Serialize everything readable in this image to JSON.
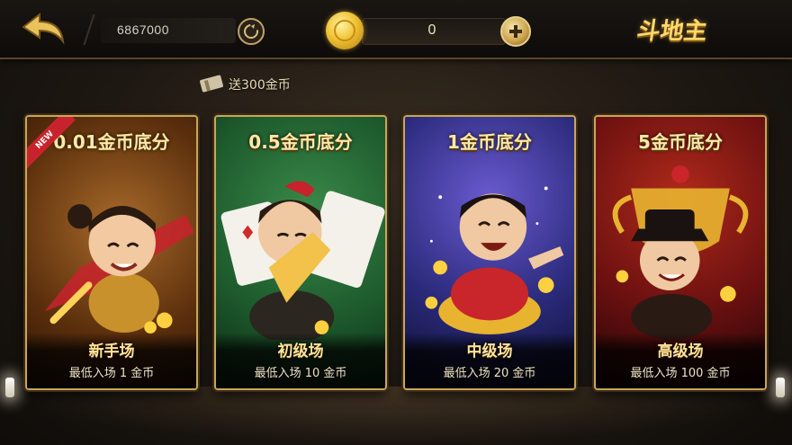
{
  "header": {
    "user_id": "6867000",
    "coins": "0",
    "game_logo": "斗地主"
  },
  "promo": {
    "text": "送300金币"
  },
  "rooms": [
    {
      "title": "0.01金币底分",
      "name": "新手场",
      "min_entry": "最低入场 1 金币",
      "badge": "NEW",
      "theme_color": "#6b3a12"
    },
    {
      "title": "0.5金币底分",
      "name": "初级场",
      "min_entry": "最低入场 10 金币",
      "theme_color": "#1d5a2c"
    },
    {
      "title": "1金币底分",
      "name": "中级场",
      "min_entry": "最低入场 20 金币",
      "theme_color": "#2a2a7a"
    },
    {
      "title": "5金币底分",
      "name": "高级场",
      "min_entry": "最低入场 100 金币",
      "theme_color": "#6a1010"
    }
  ],
  "colors": {
    "gold": "#ffd86a",
    "border_gold": "#c9a55c",
    "background": "#1e1812"
  }
}
